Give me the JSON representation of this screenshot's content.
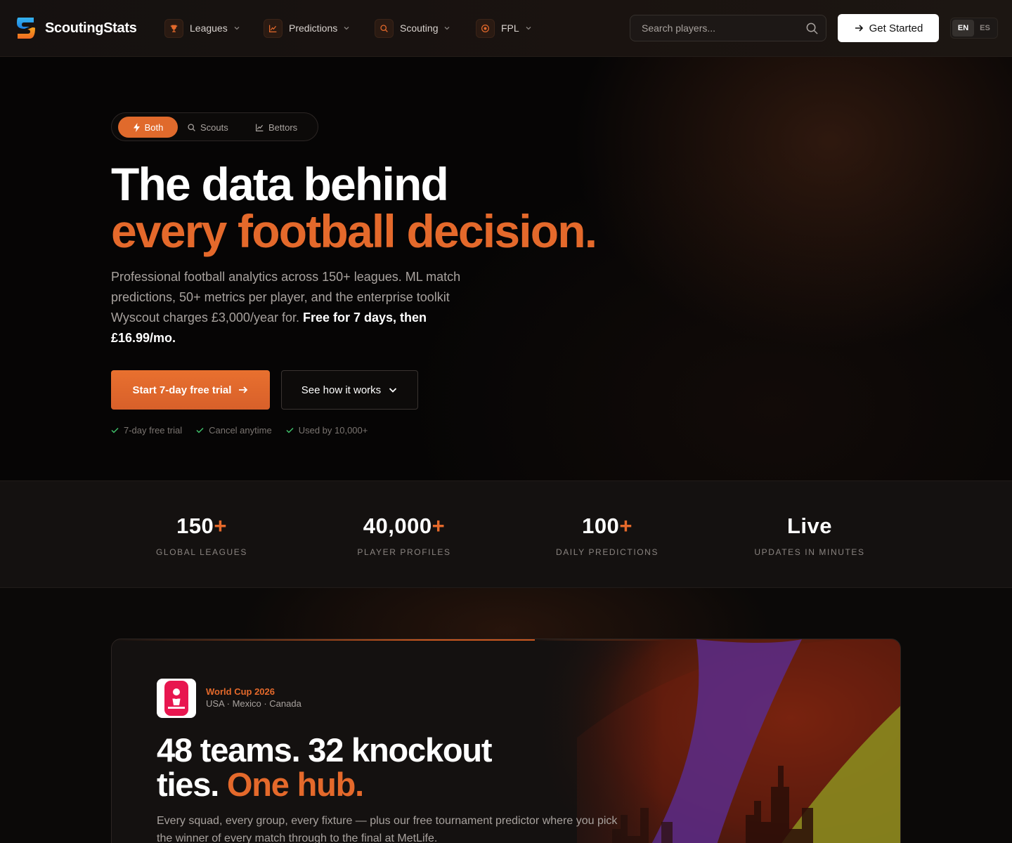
{
  "nav": {
    "brand": "ScoutingStats",
    "items": [
      {
        "label": "Leagues",
        "icon": "trophy-icon"
      },
      {
        "label": "Predictions",
        "icon": "chart-icon"
      },
      {
        "label": "Scouting",
        "icon": "search-icon"
      },
      {
        "label": "FPL",
        "icon": "target-icon"
      }
    ],
    "search_placeholder": "Search players...",
    "get_started": "Get Started",
    "lang": {
      "en": "EN",
      "es": "ES",
      "selected": "EN"
    }
  },
  "hero": {
    "audience": [
      "Both",
      "Scouts",
      "Bettors"
    ],
    "audience_selected": "Both",
    "headline_1": "The data behind",
    "headline_2": "every football decision.",
    "lead_text": "Professional football analytics across 150+ leagues. ML match predictions, 50+ metrics per player, and the enterprise toolkit Wyscout charges £3,000/year for. ",
    "lead_bold": "Free for 7 days, then £16.99/mo.",
    "cta_primary": "Start 7-day free trial",
    "cta_secondary": "See how it works",
    "checks": [
      "7-day free trial",
      "Cancel anytime",
      "Used by 10,000+"
    ]
  },
  "stats": [
    {
      "value": "150",
      "suffix": "+",
      "label": "GLOBAL LEAGUES"
    },
    {
      "value": "40,000",
      "suffix": "+",
      "label": "PLAYER PROFILES"
    },
    {
      "value": "100",
      "suffix": "+",
      "label": "DAILY PREDICTIONS"
    },
    {
      "value": "Live",
      "suffix": "",
      "label": "UPDATES IN MINUTES"
    }
  ],
  "worldcup": {
    "title": "World Cup 2026",
    "subtitle": "USA · Mexico · Canada",
    "headline_1": "48 teams. 32 knockout",
    "headline_2": "ties. ",
    "headline_accent": "One hub.",
    "description": "Every squad, every group, every fixture — plus our free tournament predictor where you pick the winner of every match through to the final at MetLife."
  },
  "colors": {
    "accent": "#e4692b",
    "background": "#0a0909",
    "check": "#3fbf6a"
  }
}
